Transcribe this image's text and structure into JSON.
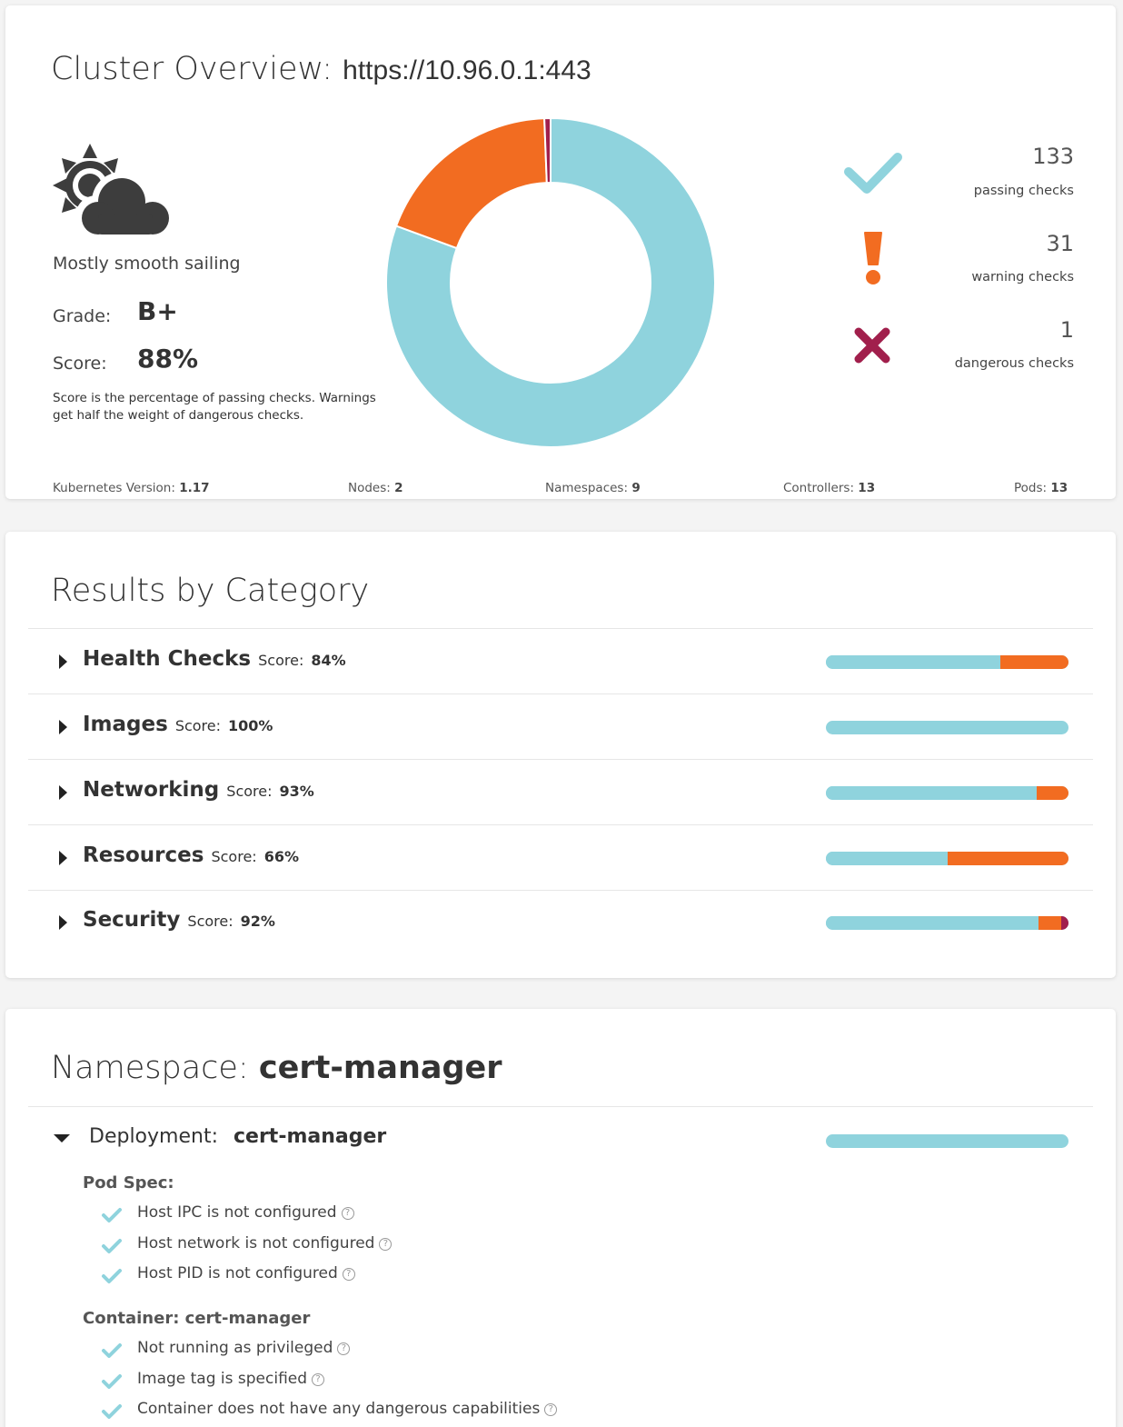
{
  "overview": {
    "title": "Cluster Overview:",
    "url": "https://10.96.0.1:443",
    "weather_icon": "sun-cloud-icon",
    "weather_text": "Mostly smooth sailing",
    "grade_label": "Grade:",
    "grade_value": "B+",
    "score_label": "Score:",
    "score_value": "88%",
    "score_note": "Score is the percentage of passing checks. Warnings get half the weight of dangerous checks.",
    "chart_data": {
      "type": "pie",
      "donut": true,
      "categories": [
        "passing checks",
        "warning checks",
        "dangerous checks"
      ],
      "values": [
        133,
        31,
        1
      ],
      "colors": [
        "#8fd3dd",
        "#f26c21",
        "#a11f4c"
      ]
    },
    "stats": [
      {
        "icon": "checkmark-icon",
        "count": "133",
        "label": "passing checks",
        "color": "#8fd3dd"
      },
      {
        "icon": "exclamation-icon",
        "count": "31",
        "label": "warning checks",
        "color": "#f26c21"
      },
      {
        "icon": "x-icon",
        "count": "1",
        "label": "dangerous checks",
        "color": "#a11f4c"
      }
    ],
    "footer": [
      {
        "label": "Kubernetes Version:",
        "value": "1.17"
      },
      {
        "label": "Nodes:",
        "value": "2"
      },
      {
        "label": "Namespaces:",
        "value": "9"
      },
      {
        "label": "Controllers:",
        "value": "13"
      },
      {
        "label": "Pods:",
        "value": "13"
      }
    ]
  },
  "categories": {
    "title": "Results by Category",
    "score_label": "Score:",
    "items": [
      {
        "name": "Health Checks",
        "score": "84%",
        "pass": 0.72,
        "warn": 0.28,
        "danger": 0
      },
      {
        "name": "Images",
        "score": "100%",
        "pass": 1,
        "warn": 0,
        "danger": 0
      },
      {
        "name": "Networking",
        "score": "93%",
        "pass": 0.87,
        "warn": 0.13,
        "danger": 0
      },
      {
        "name": "Resources",
        "score": "66%",
        "pass": 0.5,
        "warn": 0.5,
        "danger": 0
      },
      {
        "name": "Security",
        "score": "92%",
        "pass": 0.875,
        "warn": 0.095,
        "danger": 0.03
      }
    ]
  },
  "namespace": {
    "label": "Namespace:",
    "name": "cert-manager",
    "deployment_label": "Deployment:",
    "deployment_name": "cert-manager",
    "deployment_pass": 1,
    "pod_spec_label": "Pod Spec:",
    "pod_checks": [
      "Host IPC is not configured",
      "Host network is not configured",
      "Host PID is not configured"
    ],
    "container_label": "Container: cert-manager",
    "container_checks": [
      "Not running as privileged",
      "Image tag is specified",
      "Container does not have any dangerous capabilities"
    ],
    "help_glyph": "?",
    "colors": {
      "pass": "#8fd3dd",
      "warn": "#f26c21",
      "danger": "#a11f4c"
    }
  }
}
